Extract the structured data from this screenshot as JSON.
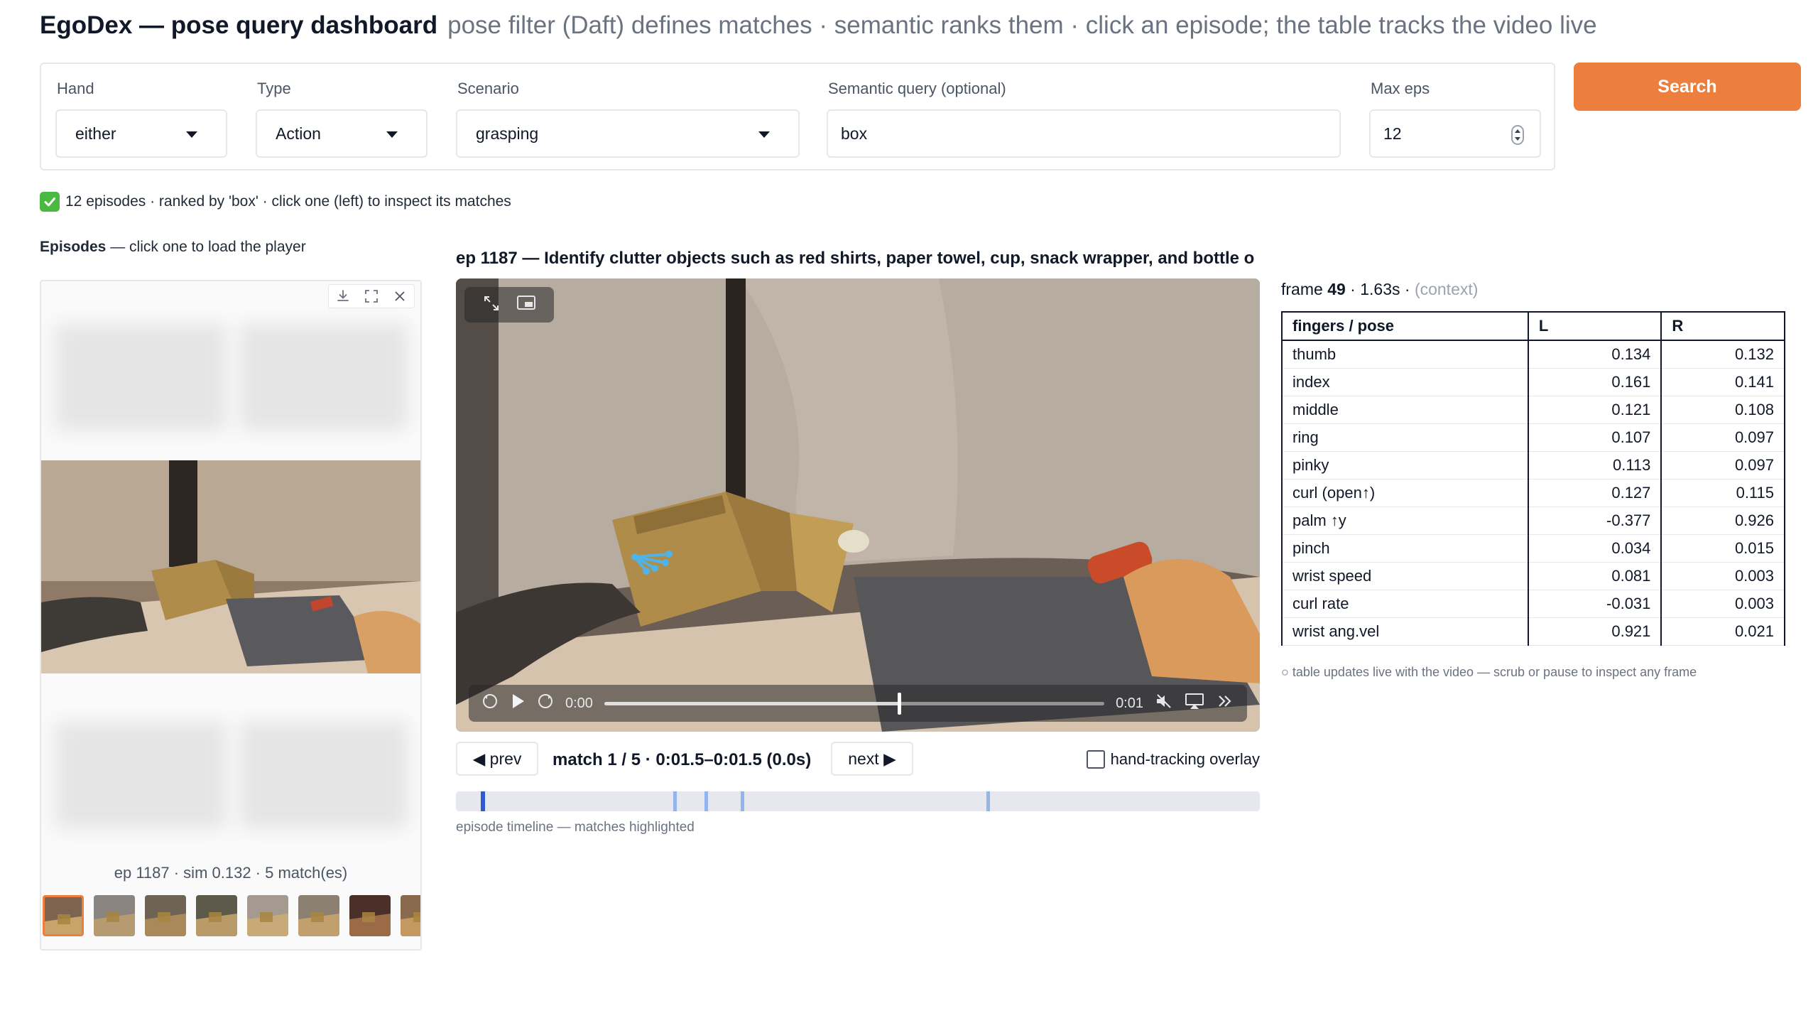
{
  "header": {
    "title": "EgoDex — pose query dashboard",
    "subtitle": "pose filter (Daft) defines matches · semantic ranks them · click an episode; the table tracks the video live"
  },
  "controls": {
    "hand": {
      "label": "Hand",
      "value": "either"
    },
    "type": {
      "label": "Type",
      "value": "Action"
    },
    "scenario": {
      "label": "Scenario",
      "value": "grasping"
    },
    "semantic_query": {
      "label": "Semantic query (optional)",
      "value": "box"
    },
    "max_eps": {
      "label": "Max eps",
      "value": "12"
    },
    "search_label": "Search"
  },
  "status": {
    "text": "12 episodes · ranked by 'box' · click one (left) to inspect its matches"
  },
  "episodes": {
    "label_bold": "Episodes",
    "label_rest": "— click one to load the player",
    "caption": "ep 1187 · sim 0.132 · 5 match(es)",
    "thumb_count": 8
  },
  "video": {
    "title": "ep 1187 — Identify clutter objects such as red shirts, paper towel, cup, snack wrapper, and bottle o",
    "current_time": "0:00",
    "duration": "0:01",
    "progress": 0.59
  },
  "match_nav": {
    "prev_label": "◀ prev",
    "next_label": "next ▶",
    "info": "match 1 / 5 · 0:01.5–0:01.5 (0.0s)",
    "overlay_label": "hand-tracking overlay",
    "overlay_checked": false
  },
  "timeline": {
    "caption": "episode timeline — matches highlighted",
    "cursor": 0.031,
    "matches": [
      0.27,
      0.309,
      0.354,
      0.66
    ]
  },
  "frame": {
    "label": "frame",
    "number": "49",
    "time": "· 1.63s ·",
    "context": "(context)"
  },
  "pose_table": {
    "headers": [
      "fingers / pose",
      "L",
      "R"
    ],
    "rows": [
      [
        "thumb",
        "0.134",
        "0.132"
      ],
      [
        "index",
        "0.161",
        "0.141"
      ],
      [
        "middle",
        "0.121",
        "0.108"
      ],
      [
        "ring",
        "0.107",
        "0.097"
      ],
      [
        "pinky",
        "0.113",
        "0.097"
      ],
      [
        "curl (open↑)",
        "0.127",
        "0.115"
      ],
      [
        "palm ↑y",
        "-0.377",
        "0.926"
      ],
      [
        "pinch",
        "0.034",
        "0.015"
      ],
      [
        "wrist speed",
        "0.081",
        "0.003"
      ],
      [
        "curl rate",
        "-0.031",
        "0.003"
      ],
      [
        "wrist ang.vel",
        "0.921",
        "0.021"
      ]
    ],
    "note": "○ table updates live with the video — scrub or pause to inspect any frame"
  }
}
